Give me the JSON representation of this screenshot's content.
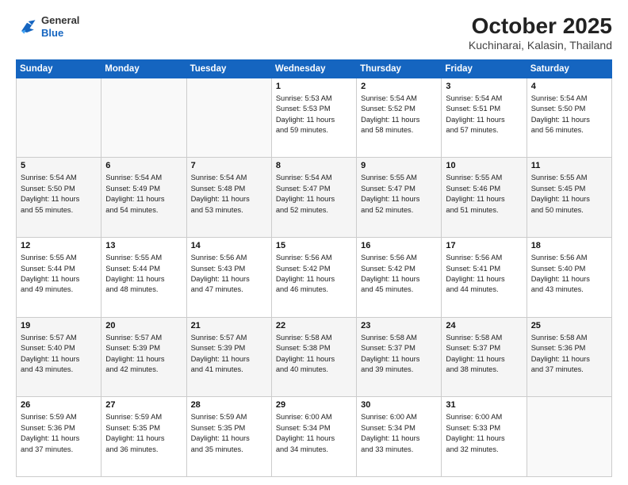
{
  "header": {
    "logo_general": "General",
    "logo_blue": "Blue",
    "title": "October 2025",
    "subtitle": "Kuchinarai, Kalasin, Thailand"
  },
  "weekdays": [
    "Sunday",
    "Monday",
    "Tuesday",
    "Wednesday",
    "Thursday",
    "Friday",
    "Saturday"
  ],
  "weeks": [
    [
      {
        "day": "",
        "info": ""
      },
      {
        "day": "",
        "info": ""
      },
      {
        "day": "",
        "info": ""
      },
      {
        "day": "1",
        "info": "Sunrise: 5:53 AM\nSunset: 5:53 PM\nDaylight: 11 hours\nand 59 minutes."
      },
      {
        "day": "2",
        "info": "Sunrise: 5:54 AM\nSunset: 5:52 PM\nDaylight: 11 hours\nand 58 minutes."
      },
      {
        "day": "3",
        "info": "Sunrise: 5:54 AM\nSunset: 5:51 PM\nDaylight: 11 hours\nand 57 minutes."
      },
      {
        "day": "4",
        "info": "Sunrise: 5:54 AM\nSunset: 5:50 PM\nDaylight: 11 hours\nand 56 minutes."
      }
    ],
    [
      {
        "day": "5",
        "info": "Sunrise: 5:54 AM\nSunset: 5:50 PM\nDaylight: 11 hours\nand 55 minutes."
      },
      {
        "day": "6",
        "info": "Sunrise: 5:54 AM\nSunset: 5:49 PM\nDaylight: 11 hours\nand 54 minutes."
      },
      {
        "day": "7",
        "info": "Sunrise: 5:54 AM\nSunset: 5:48 PM\nDaylight: 11 hours\nand 53 minutes."
      },
      {
        "day": "8",
        "info": "Sunrise: 5:54 AM\nSunset: 5:47 PM\nDaylight: 11 hours\nand 52 minutes."
      },
      {
        "day": "9",
        "info": "Sunrise: 5:55 AM\nSunset: 5:47 PM\nDaylight: 11 hours\nand 52 minutes."
      },
      {
        "day": "10",
        "info": "Sunrise: 5:55 AM\nSunset: 5:46 PM\nDaylight: 11 hours\nand 51 minutes."
      },
      {
        "day": "11",
        "info": "Sunrise: 5:55 AM\nSunset: 5:45 PM\nDaylight: 11 hours\nand 50 minutes."
      }
    ],
    [
      {
        "day": "12",
        "info": "Sunrise: 5:55 AM\nSunset: 5:44 PM\nDaylight: 11 hours\nand 49 minutes."
      },
      {
        "day": "13",
        "info": "Sunrise: 5:55 AM\nSunset: 5:44 PM\nDaylight: 11 hours\nand 48 minutes."
      },
      {
        "day": "14",
        "info": "Sunrise: 5:56 AM\nSunset: 5:43 PM\nDaylight: 11 hours\nand 47 minutes."
      },
      {
        "day": "15",
        "info": "Sunrise: 5:56 AM\nSunset: 5:42 PM\nDaylight: 11 hours\nand 46 minutes."
      },
      {
        "day": "16",
        "info": "Sunrise: 5:56 AM\nSunset: 5:42 PM\nDaylight: 11 hours\nand 45 minutes."
      },
      {
        "day": "17",
        "info": "Sunrise: 5:56 AM\nSunset: 5:41 PM\nDaylight: 11 hours\nand 44 minutes."
      },
      {
        "day": "18",
        "info": "Sunrise: 5:56 AM\nSunset: 5:40 PM\nDaylight: 11 hours\nand 43 minutes."
      }
    ],
    [
      {
        "day": "19",
        "info": "Sunrise: 5:57 AM\nSunset: 5:40 PM\nDaylight: 11 hours\nand 43 minutes."
      },
      {
        "day": "20",
        "info": "Sunrise: 5:57 AM\nSunset: 5:39 PM\nDaylight: 11 hours\nand 42 minutes."
      },
      {
        "day": "21",
        "info": "Sunrise: 5:57 AM\nSunset: 5:39 PM\nDaylight: 11 hours\nand 41 minutes."
      },
      {
        "day": "22",
        "info": "Sunrise: 5:58 AM\nSunset: 5:38 PM\nDaylight: 11 hours\nand 40 minutes."
      },
      {
        "day": "23",
        "info": "Sunrise: 5:58 AM\nSunset: 5:37 PM\nDaylight: 11 hours\nand 39 minutes."
      },
      {
        "day": "24",
        "info": "Sunrise: 5:58 AM\nSunset: 5:37 PM\nDaylight: 11 hours\nand 38 minutes."
      },
      {
        "day": "25",
        "info": "Sunrise: 5:58 AM\nSunset: 5:36 PM\nDaylight: 11 hours\nand 37 minutes."
      }
    ],
    [
      {
        "day": "26",
        "info": "Sunrise: 5:59 AM\nSunset: 5:36 PM\nDaylight: 11 hours\nand 37 minutes."
      },
      {
        "day": "27",
        "info": "Sunrise: 5:59 AM\nSunset: 5:35 PM\nDaylight: 11 hours\nand 36 minutes."
      },
      {
        "day": "28",
        "info": "Sunrise: 5:59 AM\nSunset: 5:35 PM\nDaylight: 11 hours\nand 35 minutes."
      },
      {
        "day": "29",
        "info": "Sunrise: 6:00 AM\nSunset: 5:34 PM\nDaylight: 11 hours\nand 34 minutes."
      },
      {
        "day": "30",
        "info": "Sunrise: 6:00 AM\nSunset: 5:34 PM\nDaylight: 11 hours\nand 33 minutes."
      },
      {
        "day": "31",
        "info": "Sunrise: 6:00 AM\nSunset: 5:33 PM\nDaylight: 11 hours\nand 32 minutes."
      },
      {
        "day": "",
        "info": ""
      }
    ]
  ]
}
